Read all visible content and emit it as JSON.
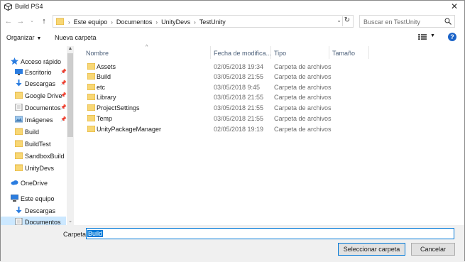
{
  "window": {
    "title": "Build PS4"
  },
  "address": {
    "crumbs": [
      "Este equipo",
      "Documentos",
      "UnityDevs",
      "TestUnity"
    ]
  },
  "search": {
    "placeholder": "Buscar en TestUnity"
  },
  "toolbar": {
    "organize": "Organizar",
    "new_folder": "Nueva carpeta"
  },
  "sidebar": {
    "items": [
      {
        "label": "Acceso rápido",
        "icon": "star-icon",
        "pinned": false
      },
      {
        "label": "Escritorio",
        "icon": "desktop-icon",
        "pinned": true
      },
      {
        "label": "Descargas",
        "icon": "download-icon",
        "pinned": true
      },
      {
        "label": "Google Drive",
        "icon": "folder-icon",
        "pinned": true
      },
      {
        "label": "Documentos",
        "icon": "documents-icon",
        "pinned": true
      },
      {
        "label": "Imágenes",
        "icon": "pictures-icon",
        "pinned": true
      },
      {
        "label": "Build",
        "icon": "folder-icon",
        "pinned": false
      },
      {
        "label": "BuildTest",
        "icon": "folder-icon",
        "pinned": false
      },
      {
        "label": "SandboxBuild",
        "icon": "folder-icon",
        "pinned": false
      },
      {
        "label": "UnityDevs",
        "icon": "folder-icon",
        "pinned": false
      },
      {
        "label": "OneDrive",
        "icon": "cloud-icon",
        "pinned": false
      },
      {
        "label": "Este equipo",
        "icon": "computer-icon",
        "pinned": false
      },
      {
        "label": "Descargas",
        "icon": "download-icon",
        "pinned": false
      },
      {
        "label": "Documentos",
        "icon": "documents-icon",
        "pinned": false,
        "selected": true
      }
    ]
  },
  "columns": {
    "name": "Nombre",
    "date": "Fecha de modifica...",
    "type": "Tipo",
    "size": "Tamaño"
  },
  "files": [
    {
      "name": "Assets",
      "date": "02/05/2018 19:34",
      "type": "Carpeta de archivos"
    },
    {
      "name": "Build",
      "date": "03/05/2018 21:55",
      "type": "Carpeta de archivos"
    },
    {
      "name": "etc",
      "date": "03/05/2018 9:45",
      "type": "Carpeta de archivos"
    },
    {
      "name": "Library",
      "date": "03/05/2018 21:55",
      "type": "Carpeta de archivos"
    },
    {
      "name": "ProjectSettings",
      "date": "03/05/2018 21:55",
      "type": "Carpeta de archivos"
    },
    {
      "name": "Temp",
      "date": "03/05/2018 21:55",
      "type": "Carpeta de archivos"
    },
    {
      "name": "UnityPackageManager",
      "date": "02/05/2018 19:19",
      "type": "Carpeta de archivos"
    }
  ],
  "bottom": {
    "folder_label": "Carpeta:",
    "folder_value": "Build",
    "select_label": "Seleccionar carpeta",
    "cancel_label": "Cancelar"
  },
  "colors": {
    "accent": "#0078d7",
    "folder": "#f8d775",
    "selection": "#cce8ff"
  }
}
